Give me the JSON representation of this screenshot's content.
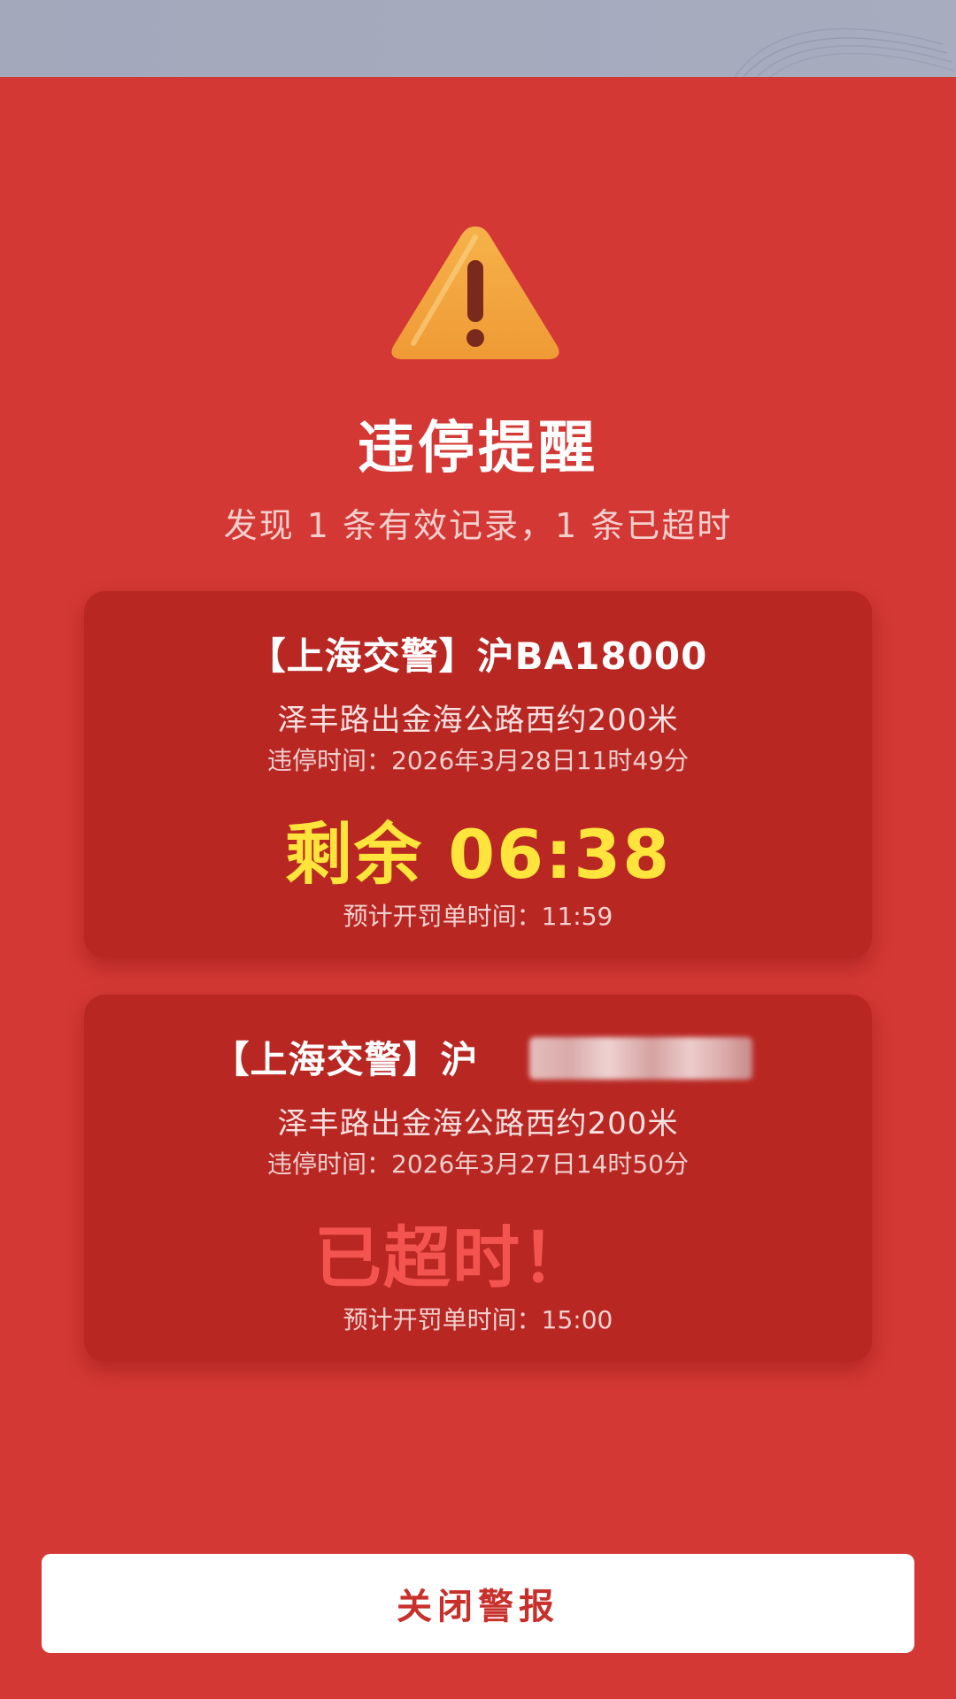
{
  "alert": {
    "title": "违停提醒",
    "subtitle": "发现 1 条有效记录，1 条已超时",
    "icon": "warning-triangle-icon"
  },
  "records": [
    {
      "title": "【上海交警】沪BA18000",
      "location": "泽丰路出金海公路西约200米",
      "violation_time": "违停时间：2026年3月28日11时49分",
      "status": "剩余 06:38",
      "ticket_time": "预计开罚单时间：11:59"
    },
    {
      "title": "【上海交警】沪",
      "location": "泽丰路出金海公路西约200米",
      "violation_time": "违停时间：2026年3月27日14时50分",
      "status": "已超时！",
      "ticket_time": "预计开罚单时间：15:00"
    }
  ],
  "close_button_label": "关闭警报",
  "colors": {
    "background": "#d33834",
    "card": "#b92723",
    "countdown": "#ffe43b",
    "overdue": "#f45450",
    "button_text": "#c8302b"
  }
}
